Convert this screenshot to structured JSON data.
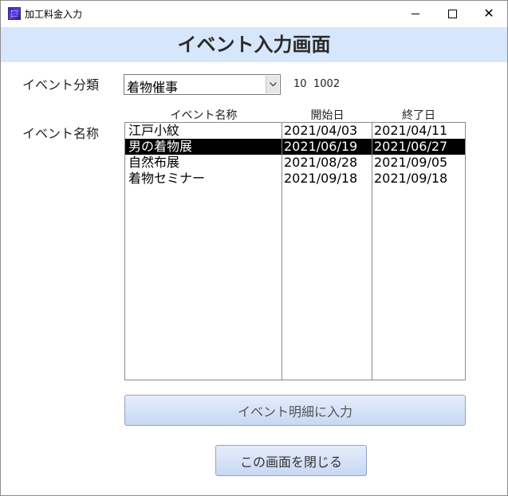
{
  "window": {
    "title": "加工料金入力",
    "controls": [
      "minimize",
      "maximize",
      "close"
    ]
  },
  "header": {
    "title": "イベント入力画面"
  },
  "form": {
    "category_label": "イベント分類",
    "category_value": "着物催事",
    "code_a": "10",
    "code_b": "1002",
    "name_label": "イベント名称"
  },
  "list": {
    "columns": [
      "イベント名称",
      "開始日",
      "終了日"
    ],
    "rows": [
      {
        "name": "江戸小紋",
        "start": "2021/04/03",
        "end": "2021/04/11",
        "selected": false
      },
      {
        "name": "男の着物展",
        "start": "2021/06/19",
        "end": "2021/06/27",
        "selected": true
      },
      {
        "name": "自然布展",
        "start": "2021/08/28",
        "end": "2021/09/05",
        "selected": false
      },
      {
        "name": "着物セミナー",
        "start": "2021/09/18",
        "end": "2021/09/18",
        "selected": false
      }
    ]
  },
  "buttons": {
    "detail": "イベント明細に入力",
    "close": "この画面を閉じる"
  },
  "colors": {
    "header_band": "#d7e7fb",
    "button_gradient_top": "#e5edfb",
    "button_gradient_bottom": "#c8d8f3",
    "selection": "#000000"
  }
}
